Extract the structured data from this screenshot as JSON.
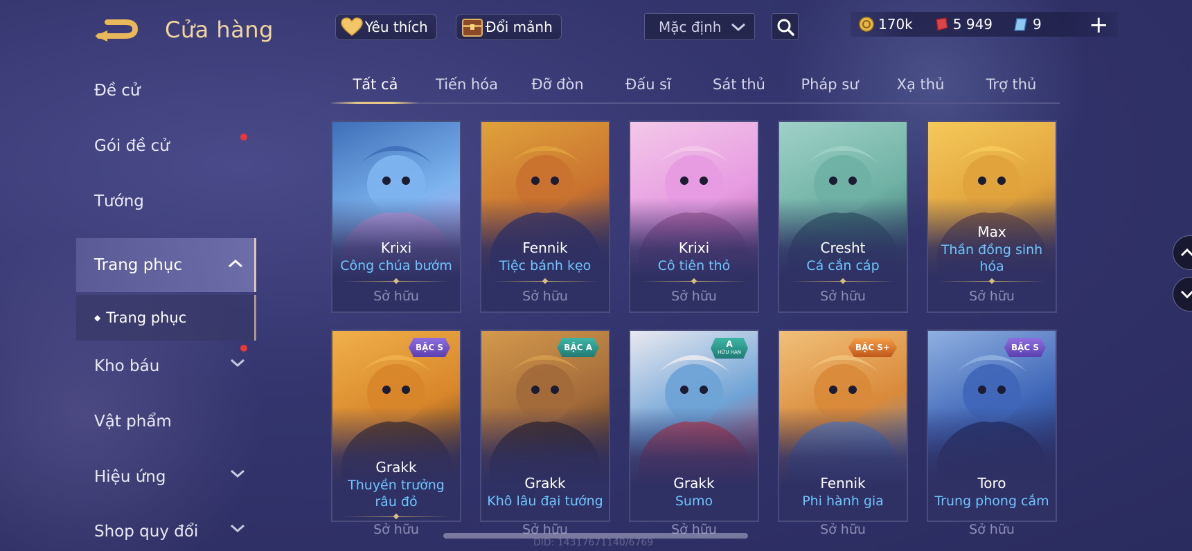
{
  "header": {
    "title": "Cửa hàng",
    "back_icon": "back-arrow-icon",
    "favorite_label": "Yêu thích",
    "exchange_label": "Đổi mảnh",
    "sort_value": "Mặc định",
    "currency": {
      "gold": "170k",
      "vouchers": "5 949",
      "gems": "9"
    },
    "plus_label": "+"
  },
  "sidebar": {
    "items": [
      {
        "label": "Đề cử"
      },
      {
        "label": "Gói đề cử"
      },
      {
        "label": "Tướng"
      },
      {
        "label": "Trang phục"
      },
      {
        "label": "Kho báu"
      },
      {
        "label": "Vật phẩm"
      },
      {
        "label": "Hiệu ứng"
      },
      {
        "label": "Shop quy đổi"
      }
    ],
    "subitem": "Trang phục"
  },
  "tabs": [
    {
      "label": "Tất cả"
    },
    {
      "label": "Tiến hóa"
    },
    {
      "label": "Đỡ đòn"
    },
    {
      "label": "Đấu sĩ"
    },
    {
      "label": "Sát thủ"
    },
    {
      "label": "Pháp sư"
    },
    {
      "label": "Xạ thủ"
    },
    {
      "label": "Trợ thủ"
    }
  ],
  "cards": [
    {
      "hero": "Krixi",
      "skin": "Công chúa bướm",
      "status": "Sở hữu",
      "badge": "",
      "colors": [
        "#7db4ef",
        "#c9a2e6",
        "#3e6fb8"
      ]
    },
    {
      "hero": "Fennik",
      "skin": "Tiệc bánh kẹo",
      "status": "Sở hữu",
      "badge": "",
      "colors": [
        "#c9722f",
        "#2b2d63",
        "#e0a23c"
      ]
    },
    {
      "hero": "Krixi",
      "skin": "Cô tiên thỏ",
      "status": "Sở hữu",
      "badge": "",
      "colors": [
        "#e79be1",
        "#b05c9e",
        "#f3c8e9"
      ]
    },
    {
      "hero": "Cresht",
      "skin": "Cá cắn cáp",
      "status": "Sở hữu",
      "badge": "",
      "colors": [
        "#6fb1a4",
        "#2c5d60",
        "#9fd1c7"
      ]
    },
    {
      "hero": "Max",
      "skin": "Thần đồng sinh hóa",
      "status": "Sở hữu",
      "badge": "",
      "colors": [
        "#e0a23c",
        "#6c4a3a",
        "#f5c95a"
      ]
    },
    {
      "hero": "Grakk",
      "skin": "Thuyền trưởng râu đỏ",
      "status": "Sở hữu",
      "badge": "BẬC S",
      "colors": [
        "#d8862a",
        "#3d2a1e",
        "#f0b04a"
      ]
    },
    {
      "hero": "Grakk",
      "skin": "Khô lâu đại tướng",
      "status": "Sở hữu",
      "badge": "BẬC A",
      "colors": [
        "#a36a3a",
        "#2a1f1c",
        "#d49a4c"
      ]
    },
    {
      "hero": "Grakk",
      "skin": "Sumo",
      "status": "Sở hữu",
      "badge": "A",
      "colors": [
        "#6fa3d6",
        "#c23a4a",
        "#e9e9f0"
      ]
    },
    {
      "hero": "Fennik",
      "skin": "Phi hành gia",
      "status": "Sở hữu",
      "badge": "BẬC S+",
      "colors": [
        "#d98a3a",
        "#5b86c8",
        "#f1c07a"
      ]
    },
    {
      "hero": "Toro",
      "skin": "Trung phong cắm",
      "status": "Sở hữu",
      "badge": "BẬC S",
      "colors": [
        "#3f66b8",
        "#1f2a5c",
        "#8fb0e0"
      ]
    }
  ],
  "badge_sub_label": "HỮU HẠN",
  "footer": {
    "did": "DID: 14317671140/6769"
  }
}
